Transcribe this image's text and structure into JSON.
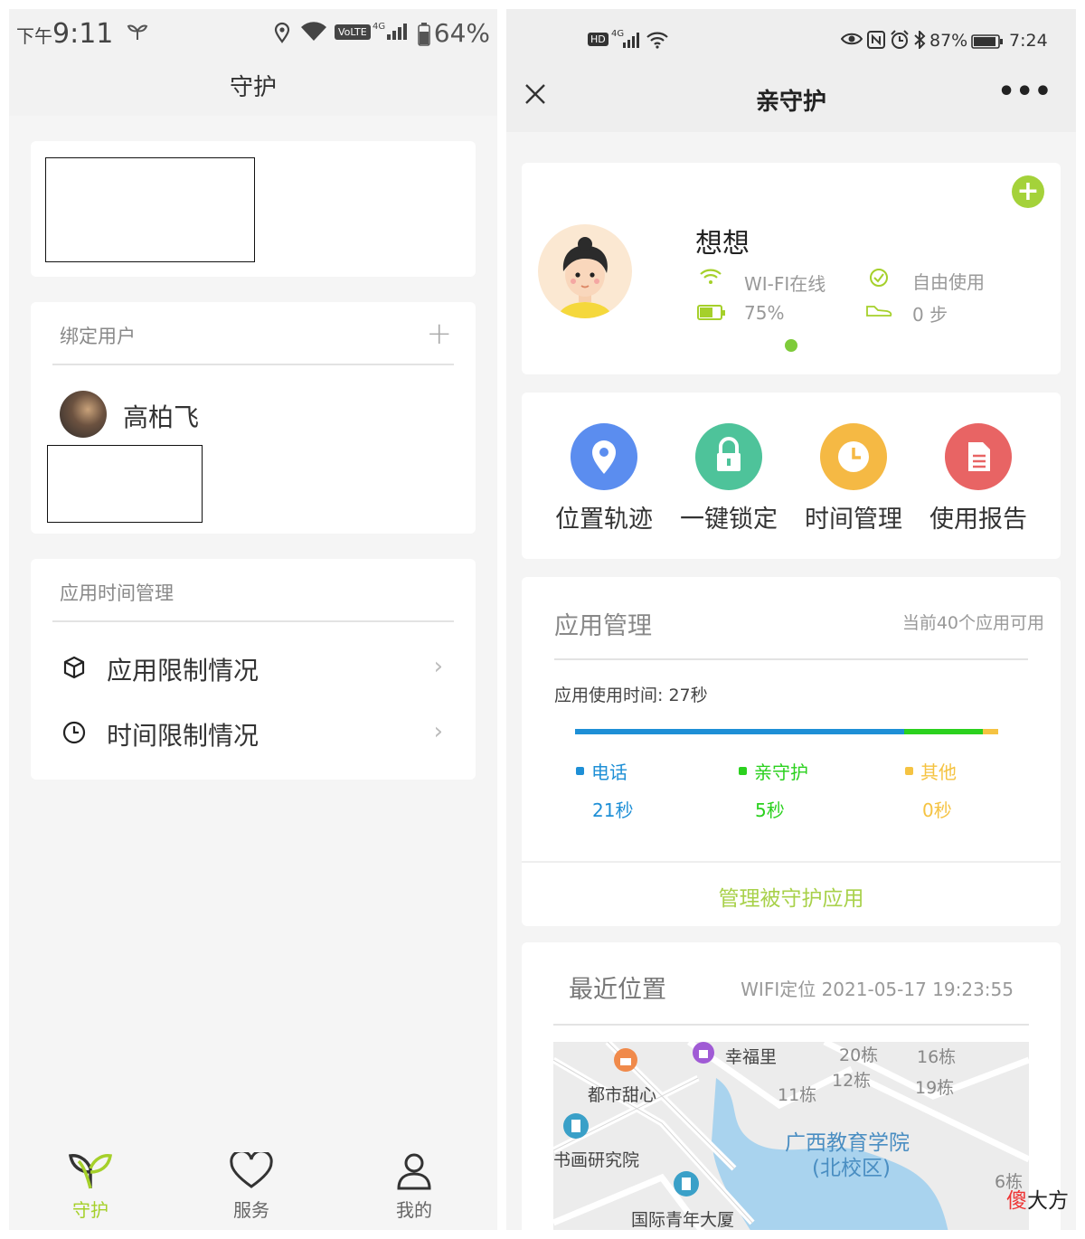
{
  "left": {
    "status": {
      "prefix": "下午",
      "time": "9:11",
      "volte": "VoLTE",
      "net": "4G",
      "battery": "64%"
    },
    "title": "守护",
    "bind_section": {
      "header": "绑定用户",
      "user_name": "高柏飞"
    },
    "app_time_section": {
      "header": "应用时间管理",
      "items": [
        {
          "label": "应用限制情况",
          "icon": "cube-icon"
        },
        {
          "label": "时间限制情况",
          "icon": "clock-icon"
        }
      ]
    },
    "tabs": [
      {
        "label": "守护",
        "icon": "sprout-icon",
        "active": true
      },
      {
        "label": "服务",
        "icon": "heart-icon",
        "active": false
      },
      {
        "label": "我的",
        "icon": "person-icon",
        "active": false
      }
    ],
    "colors": {
      "accent": "#a5d02a"
    }
  },
  "right": {
    "status": {
      "hd": "HD",
      "net": "4G",
      "battery": "87%",
      "time": "7:24"
    },
    "title": "亲守护",
    "profile": {
      "name": "想想",
      "wifi": "WI-FI在线",
      "battery": "75%",
      "mode": "自由使用",
      "steps": "0 步"
    },
    "functions": [
      {
        "label": "位置轨迹",
        "icon": "location-pin-icon",
        "color": "#5b8def"
      },
      {
        "label": "一键锁定",
        "icon": "lock-icon",
        "color": "#4ec39a"
      },
      {
        "label": "时间管理",
        "icon": "clock-icon",
        "color": "#f5b944"
      },
      {
        "label": "使用报告",
        "icon": "document-icon",
        "color": "#e86464"
      }
    ],
    "app_manage": {
      "title": "应用管理",
      "available": "当前40个应用可用",
      "usage_text": "应用使用时间: 27秒",
      "usage_bar": {
        "total_seconds": 27,
        "parts": [
          21,
          5,
          1
        ]
      },
      "legend": [
        {
          "name": "电话",
          "value": "21秒",
          "color": "#1e8fd6"
        },
        {
          "name": "亲守护",
          "value": "5秒",
          "color": "#2bd11e"
        },
        {
          "name": "其他",
          "value": "0秒",
          "color": "#f5c342"
        }
      ],
      "manage_link": "管理被守护应用"
    },
    "location": {
      "title": "最近位置",
      "detail": "WIFI定位 2021-05-17 19:23:55",
      "map_labels": [
        "幸福里",
        "都市甜心",
        "书画研究院",
        "国际青年大厦",
        "广西教育学院",
        "(北校区)",
        "20栋",
        "16栋",
        "12栋",
        "19栋",
        "11栋",
        "6栋"
      ]
    },
    "watermark": {
      "prefix": "傻",
      "suffix": "大方"
    }
  }
}
